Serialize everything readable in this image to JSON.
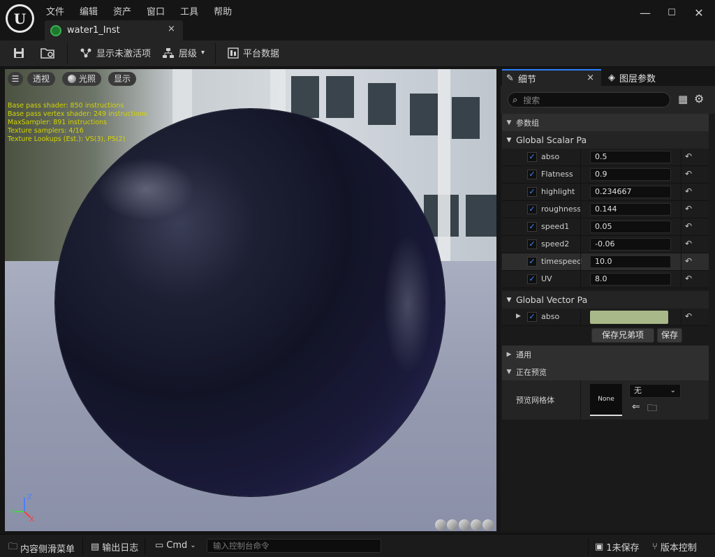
{
  "app": {
    "logo_glyph": "U",
    "menu": [
      "文件",
      "编辑",
      "资产",
      "窗口",
      "工具",
      "帮助"
    ],
    "window_controls": {
      "minimize": "—",
      "maximize": "☐",
      "close": "✕"
    }
  },
  "tab": {
    "title": "water1_Inst",
    "close": "×",
    "icon": "material-instance-icon"
  },
  "toolbar": {
    "save_icon": "save-icon",
    "browse_icon": "browse-icon",
    "show_inactive_label": "显示未激活项",
    "hierarchy_label": "层级",
    "platform_stats_label": "平台数据"
  },
  "viewport": {
    "perspective_label": "透视",
    "lit_label": "光照",
    "show_label": "显示",
    "stats": [
      "Base pass shader: 850 instructions",
      "Base pass vertex shader: 249 instructions",
      "MaxSampler: 891 instructions",
      "Texture samplers: 4/16",
      "Texture Lookups (Est.): VS(3), PS(2)"
    ],
    "axis": {
      "z": "Z",
      "y": "Y",
      "x": "X"
    }
  },
  "details": {
    "tab_details": "细节",
    "tab_close": "×",
    "tab_layers": "图层参数",
    "search_placeholder": "搜索",
    "param_groups": "参数组",
    "scalar_group": "Global Scalar Pa",
    "scalar_params": [
      {
        "name": "abso",
        "value": "0.5"
      },
      {
        "name": "Flatness",
        "value": "0.9"
      },
      {
        "name": "highlight",
        "value": "0.234667"
      },
      {
        "name": "roughness",
        "value": "0.144"
      },
      {
        "name": "speed1",
        "value": "0.05"
      },
      {
        "name": "speed2",
        "value": "-0.06"
      },
      {
        "name": "timespeed",
        "value": "10.0"
      },
      {
        "name": "UV",
        "value": "8.0"
      }
    ],
    "vector_group": "Global Vector Pa",
    "vector_param": {
      "name": "abso",
      "color": "#a9b889"
    },
    "save_siblings": "保存兄弟项",
    "save_children": "保存",
    "general": "通用",
    "previewing": "正在预览",
    "preview_mesh_label": "预览网格体",
    "thumb_label": "None",
    "mesh_select": "无",
    "checkmark": "✓",
    "reset_glyph": "↶"
  },
  "statusbar": {
    "content_drawer": "内容侧滑菜单",
    "output_log": "输出日志",
    "cmd": "Cmd",
    "cmd_placeholder": "输入控制台命令",
    "unsaved": "1未保存",
    "source_control": "版本控制"
  },
  "colors": {
    "accent": "#2a7fff",
    "background": "#151515",
    "panel": "#242424"
  }
}
